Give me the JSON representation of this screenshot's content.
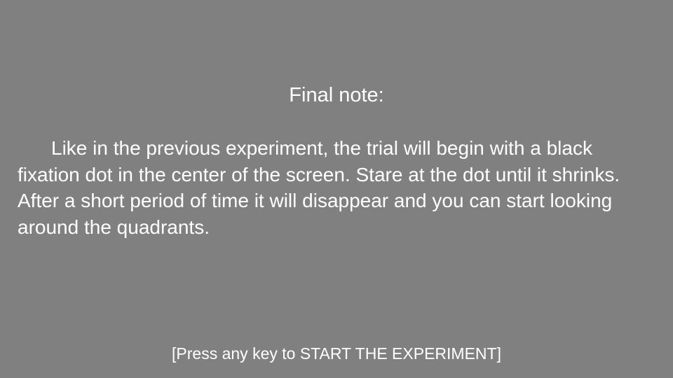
{
  "screen": {
    "title": "Final note:",
    "body": "Like in the previous experiment, the trial will begin with a black fixation dot in the center of the screen. Stare at the dot until it shrinks. After a short period of time it will disappear and you can start looking around the quadrants.",
    "prompt": "[Press any key to START THE EXPERIMENT]"
  },
  "colors": {
    "background": "#808080",
    "text": "#ffffff"
  }
}
